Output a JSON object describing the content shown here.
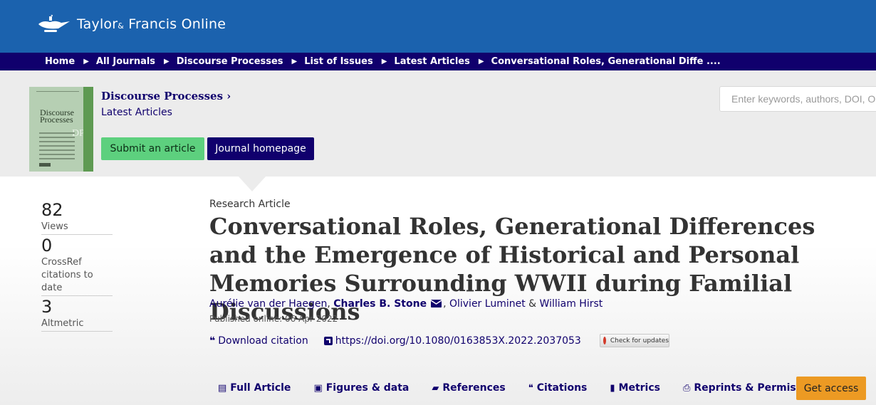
{
  "brand": {
    "name_part1": "Taylor",
    "amp": "&",
    "name_part2": " Francis Online"
  },
  "breadcrumb": [
    {
      "label": "Home"
    },
    {
      "label": "All Journals"
    },
    {
      "label": "Discourse Processes"
    },
    {
      "label": "List of Issues"
    },
    {
      "label": "Latest Articles"
    },
    {
      "label": "Conversational Roles, Generational Diffe ...."
    }
  ],
  "journal": {
    "cover_title_line1": "Discourse",
    "cover_title_line2": "Processes",
    "cover_abbrev": "DP",
    "title": "Discourse Processes",
    "title_chevron": "›",
    "subtitle": "Latest Articles",
    "submit_label": "Submit an article",
    "homepage_label": "Journal homepage"
  },
  "search": {
    "placeholder": "Enter keywords, authors, DOI, ORCID"
  },
  "metrics": [
    {
      "value": "82",
      "label": "Views"
    },
    {
      "value": "0",
      "label": "CrossRef citations to date"
    },
    {
      "value": "3",
      "label": "Altmetric"
    }
  ],
  "article": {
    "type": "Research Article",
    "title": "Conversational Roles, Generational Differences and the Emergence of Historical and Personal Memories Surrounding WWII during Familial Discussions",
    "authors": {
      "a1": "Aurélie van der Haegen",
      "sep1": ", ",
      "a2": "Charles B. Stone",
      "sep2": ", ",
      "a3": "Olivier Luminet",
      "sep3": " & ",
      "a4": "William Hirst"
    },
    "published": "Published online: 06 Apr 2022",
    "download_citation": "Download citation",
    "doi": "https://doi.org/10.1080/0163853X.2022.2037053",
    "check_updates": "Check for updates"
  },
  "tabs": [
    {
      "icon": "▤",
      "label": "Full Article"
    },
    {
      "icon": "▣",
      "label": "Figures & data"
    },
    {
      "icon": "▰",
      "label": "References"
    },
    {
      "icon": "❝",
      "label": "Citations"
    },
    {
      "icon": "▮",
      "label": "Metrics"
    },
    {
      "icon": "⎙",
      "label": "Reprints & Permissions"
    }
  ],
  "get_access_label": "Get access",
  "colors": {
    "brand_blue": "#1b62ae",
    "navy": "#10006d",
    "green": "#5dd07e",
    "orange": "#ec9a23"
  }
}
